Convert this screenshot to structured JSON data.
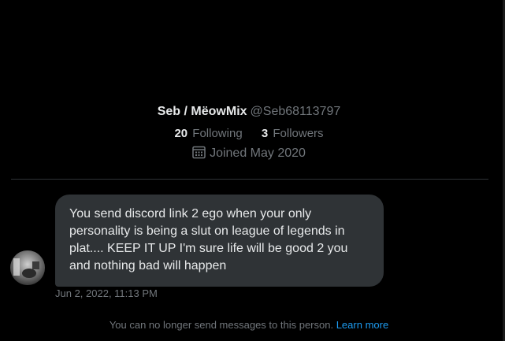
{
  "profile": {
    "display_name": "Seb / MëowMix",
    "handle": "@Seb68113797",
    "following_count": "20",
    "following_label": "Following",
    "followers_count": "3",
    "followers_label": "Followers",
    "joined_text": "Joined May 2020",
    "joined_icon": "calendar-icon"
  },
  "message": {
    "text": "You send discord link 2 ego when your only personality is being a slut on league of legends in plat.... KEEP IT UP I'm sure life will be good 2 you and nothing bad will happen",
    "timestamp": "Jun 2, 2022, 11:13 PM"
  },
  "footer": {
    "notice_text": "You can no longer send messages to this person.",
    "learn_more_label": "Learn more"
  },
  "colors": {
    "background": "#000000",
    "bubble": "#2f3336",
    "text_primary": "#e7e9ea",
    "text_secondary": "#71767b",
    "link": "#1d9bf0",
    "divider": "#2f3336"
  }
}
